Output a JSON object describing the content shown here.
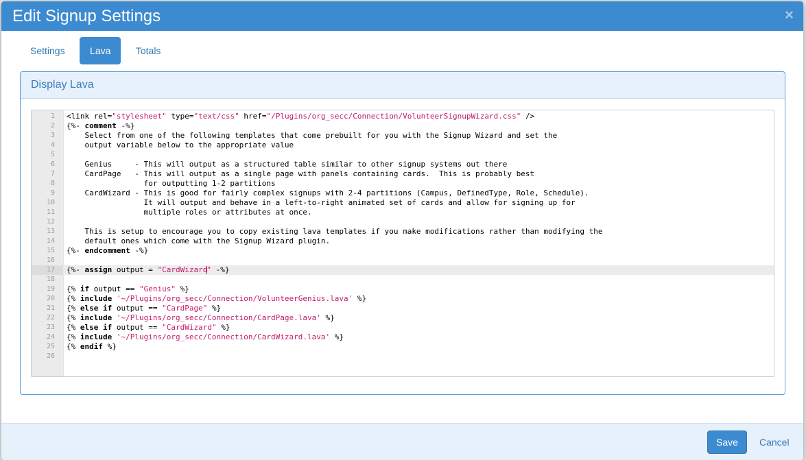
{
  "modal": {
    "title": "Edit Signup Settings",
    "close_label": "×"
  },
  "tabs": [
    {
      "label": "Settings",
      "active": false
    },
    {
      "label": "Lava",
      "active": true
    },
    {
      "label": "Totals",
      "active": false
    }
  ],
  "panel": {
    "heading": "Display Lava"
  },
  "editor": {
    "active_line": 17,
    "lines": [
      "<link rel=\"stylesheet\" type=\"text/css\" href=\"/Plugins/org_secc/Connection/VolunteerSignupWizard.css\" />",
      "{%- comment -%}",
      "    Select from one of the following templates that come prebuilt for you with the Signup Wizard and set the",
      "    output variable below to the appropriate value",
      "",
      "    Genius     - This will output as a structured table similar to other signup systems out there",
      "    CardPage   - This will output as a single page with panels containing cards.  This is probably best",
      "                 for outputting 1-2 partitions",
      "    CardWizard - This is good for fairly complex signups with 2-4 partitions (Campus, DefinedType, Role, Schedule).",
      "                 It will output and behave in a left-to-right animated set of cards and allow for signing up for",
      "                 multiple roles or attributes at once.",
      "",
      "    This is setup to encourage you to copy existing lava templates if you make modifications rather than modifying the",
      "    default ones which come with the Signup Wizard plugin.",
      "{%- endcomment -%}",
      "",
      "{%- assign output = \"CardWizard\" -%}",
      "",
      "{% if output == \"Genius\" %}",
      "{% include '~/Plugins/org_secc/Connection/VolunteerGenius.lava' %}",
      "{% else if output == \"CardPage\" %}",
      "{% include '~/Plugins/org_secc/Connection/CardPage.lava' %}",
      "{% else if output == \"CardWizard\" %}",
      "{% include '~/Plugins/org_secc/Connection/CardWizard.lava' %}",
      "{% endif %}",
      ""
    ]
  },
  "footer": {
    "save_label": "Save",
    "cancel_label": "Cancel"
  },
  "colors": {
    "header": "#3c8ad0",
    "string": "#c41a6a",
    "link": "#337ab7"
  }
}
